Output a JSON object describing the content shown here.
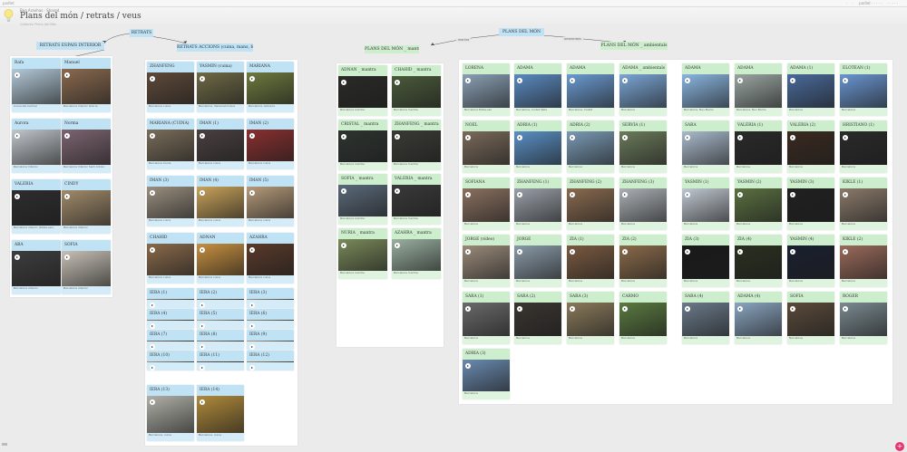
{
  "app": {
    "name": "padlet",
    "top_menu": [
      "·",
      "·",
      "padlet · · · · ·",
      "· · · · ·"
    ]
  },
  "header": {
    "breadcrumb": "Bea Aranhas · Shared",
    "title": "Plans del món / retrats / veus",
    "subtitle": "Collectiu Plans del Món"
  },
  "canvas": {
    "root": "RETRATS",
    "group_left_a": "RETRATS ESPAIS INTERIOR",
    "group_left_b": "RETRATS ACCIONS (cuina, mans, feina...)",
    "root_right": "PLANS DEL MÓN",
    "group_right_a": "PLANS DEL MÓN _ mantra",
    "group_right_b": "PLANS DEL MÓN _ ambientals",
    "connector_tags": [
      "mantra",
      "ambientals"
    ]
  },
  "columns": {
    "espais": [
      {
        "title": "Rafa",
        "cap": "Cuina del Carmel",
        "tone": "#b3c9d8",
        "color": "b"
      },
      {
        "title": "Manuel",
        "cap": "Barcelona Interior Gràcia",
        "tone": "#8a6a4f",
        "color": "b"
      },
      {
        "title": "Aurora",
        "cap": "Barcelona Interior",
        "tone": "#c0c6cc",
        "color": "b"
      },
      {
        "title": "Norma",
        "cap": "Barcelona Interior Sant Antoni",
        "tone": "#7d6470",
        "color": "b"
      },
      {
        "title": "VALERIA",
        "cap": "Barcelona interior (Poble-sec)",
        "tone": "#2d2d2d",
        "color": "b"
      },
      {
        "title": "CINDY",
        "cap": "Barcelona interior",
        "tone": "#a08a6a",
        "color": "b"
      },
      {
        "title": "ABA",
        "cap": "Barcelona interior",
        "tone": "#3d3d3d",
        "color": "b"
      },
      {
        "title": "SOFIA",
        "cap": "Barcelona interior",
        "tone": "#c7c0b5",
        "color": "b"
      }
    ],
    "accions": [
      {
        "title": "ZHANFENG",
        "cap": "Barcelona cuina",
        "tone": "#5e4a3a",
        "color": "b"
      },
      {
        "title": "YASMIN (cuina)",
        "cap": "Barcelona, Vanwood-Cuina",
        "tone": "#6f6a46",
        "color": "b"
      },
      {
        "title": "MARIANA",
        "cap": "Barcelona, Llibreria",
        "tone": "#6d7a3e",
        "color": "b"
      },
      {
        "title": "MARIANA (CUINA)",
        "cap": "Barcelona Cuina",
        "tone": "#7a6d5a",
        "color": "b"
      },
      {
        "title": "IMAN (1)",
        "cap": "Barcelona cuina",
        "tone": "#4a4040",
        "color": "b"
      },
      {
        "title": "IMAN (2)",
        "cap": "Barcelona cuina",
        "tone": "#8a2f2f",
        "color": "b"
      },
      {
        "title": "IMAN (3)",
        "cap": "Barcelona cuina",
        "tone": "#9a8f80",
        "color": "b"
      },
      {
        "title": "IMAN (4)",
        "cap": "Barcelona cuina",
        "tone": "#c9a35a",
        "color": "b"
      },
      {
        "title": "IMAN (5)",
        "cap": "Barcelona cuina",
        "tone": "#b59a7a",
        "color": "b"
      },
      {
        "title": "CHAHID",
        "cap": "Barcelona cuina",
        "tone": "#8a6a4a",
        "color": "b"
      },
      {
        "title": "ADNAN",
        "cap": "Barcelona cuina",
        "tone": "#c89040",
        "color": "b"
      },
      {
        "title": "AZAHRA",
        "cap": "Barcelona cuina",
        "tone": "#5a3a2a",
        "color": "b"
      },
      {
        "title": "IERA (1)",
        "cap": "",
        "tone": "#9a8a7a",
        "color": "b"
      },
      {
        "title": "IERA (2)",
        "cap": "",
        "tone": "#7a6a5a",
        "color": "b"
      },
      {
        "title": "IERA (3)",
        "cap": "",
        "tone": "#a09080",
        "color": "b"
      },
      {
        "title": "IERA (4)",
        "cap": "",
        "tone": "#8a7a6a",
        "color": "b"
      },
      {
        "title": "IERA (5)",
        "cap": "",
        "tone": "#b5a595",
        "color": "b"
      },
      {
        "title": "IERA (6)",
        "cap": "",
        "tone": "#9a8a7a",
        "color": "b"
      },
      {
        "title": "IERA (7)",
        "cap": "",
        "tone": "#7d6d5d",
        "color": "b"
      },
      {
        "title": "IERA (8)",
        "cap": "",
        "tone": "#8a7a6a",
        "color": "b"
      },
      {
        "title": "IERA (9)",
        "cap": "",
        "tone": "#b09a80",
        "color": "b"
      },
      {
        "title": "IERA (10)",
        "cap": "",
        "tone": "#a59585",
        "color": "b"
      },
      {
        "title": "IERA (11)",
        "cap": "",
        "tone": "#6a5a4a",
        "color": "b"
      },
      {
        "title": "IERA (12)",
        "cap": "",
        "tone": "#9a8a6a",
        "color": "b"
      },
      {
        "title": "IERA (13)",
        "cap": "Barcelona, cuina",
        "tone": "#b0b0a8",
        "color": "b"
      },
      {
        "title": "IERA (14)",
        "cap": "Barcelona, cuina",
        "tone": "#b08a3a",
        "color": "b"
      }
    ],
    "mantra": [
      {
        "title": "ADNAN _ mantra",
        "cap": "Barcelona mantra",
        "tone": "#2a2a28",
        "color": "g"
      },
      {
        "title": "CHAHID _ mantra",
        "cap": "Barcelona mantra",
        "tone": "#4a5a3a",
        "color": "g"
      },
      {
        "title": "CRISTAL _ mantra",
        "cap": "Barcelona mantra",
        "tone": "#2d3430",
        "color": "g"
      },
      {
        "title": "ZHANFENG _ mantra",
        "cap": "Barcelona mantra",
        "tone": "#3a3a35",
        "color": "g"
      },
      {
        "title": "SOFIA _ mantra",
        "cap": "Barcelona mantra",
        "tone": "#5a6a7a",
        "color": "g"
      },
      {
        "title": "VALERIA _ mantra",
        "cap": "Barcelona mantra",
        "tone": "#3a3a3a",
        "color": "g"
      },
      {
        "title": "NURIA _ mantra",
        "cap": "Barcelona mantra",
        "tone": "#7a8a5a",
        "color": "g"
      },
      {
        "title": "AZAHRA _ mantra",
        "cap": "Barcelona mantra",
        "tone": "#9ab0a0",
        "color": "g"
      }
    ],
    "ambientals": [
      {
        "title": "LORENA",
        "cap": "Barcelona Poble-sec",
        "tone": "#8aa0b5",
        "color": "g"
      },
      {
        "title": "ADAMA",
        "cap": "Barcelona, Ciutat Vella",
        "tone": "#5a8ac0",
        "color": "g"
      },
      {
        "title": "ADAMA",
        "cap": "Barcelona, Ciutat",
        "tone": "#6a9ad0",
        "color": "g"
      },
      {
        "title": "ADAMA _ ambientals",
        "cap": "Barcelona",
        "tone": "#7aa5d5",
        "color": "g"
      },
      {
        "title": "ADAMA",
        "cap": "Barcelona, Nou Barris",
        "tone": "#8ab5e0",
        "color": "g"
      },
      {
        "title": "ADAMA",
        "cap": "Barcelona, Nou Barris",
        "tone": "#9aa5a0",
        "color": "g"
      },
      {
        "title": "ADAMA (1)",
        "cap": "Barcelona",
        "tone": "#4a6a9a",
        "color": "g"
      },
      {
        "title": "ELOTEAN (1)",
        "cap": "Barcelona",
        "tone": "#6a95d0",
        "color": "g"
      },
      {
        "title": "NOEL",
        "cap": "Barcelona",
        "tone": "#7a6a5a",
        "color": "g"
      },
      {
        "title": "ADRIA (1)",
        "cap": "Barcelona",
        "tone": "#5a90c5",
        "color": "g"
      },
      {
        "title": "ADRIA (2)",
        "cap": "Barcelona",
        "tone": "#7a9ab5",
        "color": "g"
      },
      {
        "title": "SERVIA (1)",
        "cap": "Barcelona",
        "tone": "#6a7a5a",
        "color": "g"
      },
      {
        "title": "SARA",
        "cap": "Barcelona",
        "tone": "#aabacc",
        "color": "g"
      },
      {
        "title": "VALERIA (1)",
        "cap": "Barcelona",
        "tone": "#2a2a2a",
        "color": "g"
      },
      {
        "title": "VALERIA (2)",
        "cap": "Barcelona",
        "tone": "#3a2a20",
        "color": "g"
      },
      {
        "title": "HRISTIANO (1)",
        "cap": "Barcelona",
        "tone": "#2a2a2a",
        "color": "g"
      },
      {
        "title": "SOFIANA",
        "cap": "Barcelona",
        "tone": "#8a7060",
        "color": "g"
      },
      {
        "title": "ZHANFENG (1)",
        "cap": "Barcelona",
        "tone": "#9aa0a8",
        "color": "g"
      },
      {
        "title": "ZHANFENG (2)",
        "cap": "Barcelona",
        "tone": "#8a6a50",
        "color": "g"
      },
      {
        "title": "ZHANFENG (3)",
        "cap": "Barcelona",
        "tone": "#aab0b5",
        "color": "g"
      },
      {
        "title": "YASMIN (1)",
        "cap": "Barcelona",
        "tone": "#c0c8d0",
        "color": "g"
      },
      {
        "title": "YASMIN (2)",
        "cap": "Barcelona",
        "tone": "#5a7040",
        "color": "g"
      },
      {
        "title": "YASMIN (3)",
        "cap": "Barcelona",
        "tone": "#202020",
        "color": "g"
      },
      {
        "title": "KIKLE (1)",
        "cap": "Barcelona",
        "tone": "#8a7a6a",
        "color": "g"
      },
      {
        "title": "JORGE (vídeo)",
        "cap": "Barcelona",
        "tone": "#9a8a7a",
        "color": "g"
      },
      {
        "title": "JORGE",
        "cap": "Barcelona",
        "tone": "#8a9aa8",
        "color": "g"
      },
      {
        "title": "ZIA (1)",
        "cap": "Barcelona",
        "tone": "#7a5a40",
        "color": "g"
      },
      {
        "title": "ZIA (2)",
        "cap": "Barcelona",
        "tone": "#8a6a4a",
        "color": "g"
      },
      {
        "title": "ZIA (3)",
        "cap": "Barcelona",
        "tone": "#1a1a1a",
        "color": "g"
      },
      {
        "title": "ZIA (4)",
        "cap": "Barcelona",
        "tone": "#2a3020",
        "color": "g"
      },
      {
        "title": "YASMIN (4)",
        "cap": "Barcelona",
        "tone": "#1a2030",
        "color": "g"
      },
      {
        "title": "KIKLE (2)",
        "cap": "Barcelona",
        "tone": "#9a6a5a",
        "color": "g"
      },
      {
        "title": "SARA (1)",
        "cap": "Barcelona",
        "tone": "#6a6a6a",
        "color": "g"
      },
      {
        "title": "SARA (2)",
        "cap": "Barcelona",
        "tone": "#3a3530",
        "color": "g"
      },
      {
        "title": "SARA (3)",
        "cap": "Barcelona",
        "tone": "#8a7a5a",
        "color": "g"
      },
      {
        "title": "CARMO",
        "cap": "Barcelona",
        "tone": "#5a7a40",
        "color": "g"
      },
      {
        "title": "SARA (4)",
        "cap": "Barcelona",
        "tone": "#6a7a8a",
        "color": "g"
      },
      {
        "title": "ADAMA (4)",
        "cap": "Barcelona",
        "tone": "#8aa5c0",
        "color": "g"
      },
      {
        "title": "SOFIA",
        "cap": "Barcelona",
        "tone": "#5a4a3a",
        "color": "g"
      },
      {
        "title": "ROGER",
        "cap": "Barcelona",
        "tone": "#7a8a90",
        "color": "g"
      },
      {
        "title": "ADRIA (3)",
        "cap": "Barcelona",
        "tone": "#6a8ab0",
        "color": "g"
      }
    ]
  }
}
